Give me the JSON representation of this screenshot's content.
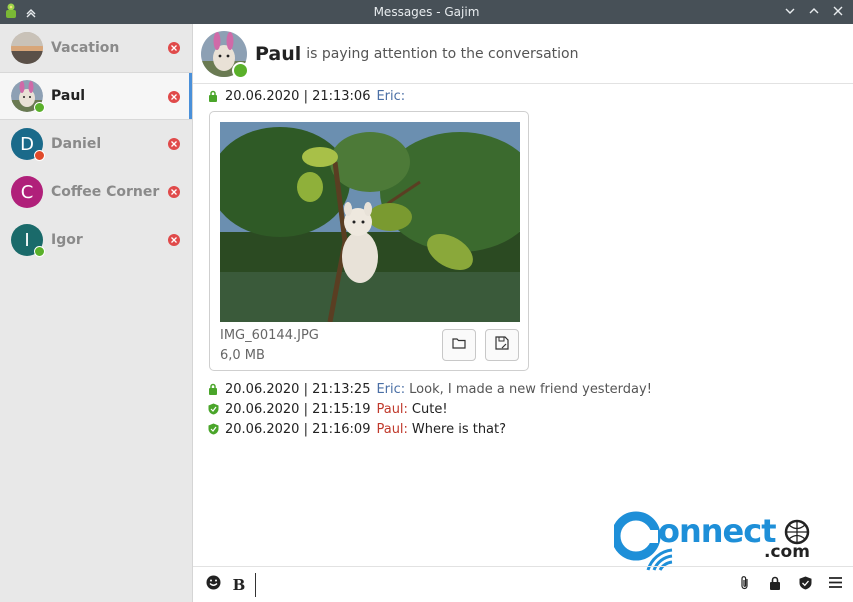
{
  "window": {
    "title": "Messages - Gajim"
  },
  "sidebar": {
    "chats": [
      {
        "name": "Vacation",
        "type": "group",
        "active": false
      },
      {
        "name": "Paul",
        "type": "contact",
        "active": true,
        "status": "online"
      },
      {
        "name": "Daniel",
        "type": "contact",
        "active": false,
        "status": "busy",
        "letter": "D"
      },
      {
        "name": "Coffee Corner",
        "type": "group",
        "active": false,
        "letter": "C"
      },
      {
        "name": "Igor",
        "type": "contact",
        "active": false,
        "status": "online",
        "letter": "I"
      }
    ]
  },
  "header": {
    "name": "Paul",
    "status_text": "is paying attention to the conversation"
  },
  "messages": [
    {
      "time": "20.06.2020 | 21:13:06",
      "sender": "Eric:",
      "text": "",
      "icon": "lock-icon"
    },
    {
      "time": "20.06.2020 | 21:13:25",
      "sender": "Eric:",
      "text": "Look, I made a new friend yesterday!",
      "icon": "lock-icon"
    },
    {
      "time": "20.06.2020 | 21:15:19",
      "sender": "Paul:",
      "text": "Cute!",
      "icon": "shield-icon"
    },
    {
      "time": "20.06.2020 | 21:16:09",
      "sender": "Paul:",
      "text": "Where is that?",
      "icon": "shield-icon"
    }
  ],
  "file": {
    "name": "IMG_60144.JPG",
    "size": "6,0 MB"
  },
  "watermark": {
    "brand": "onnect",
    "suffix": ".com"
  },
  "composer": {
    "bold_label": "B",
    "value": ""
  },
  "colors": {
    "titlebar": "#475057",
    "accent": "#4a90d9",
    "online": "#5ab02a",
    "busy": "#e04a2a",
    "eric": "#4a6fa5",
    "paul": "#c0392b",
    "close": "#e04a4a"
  }
}
